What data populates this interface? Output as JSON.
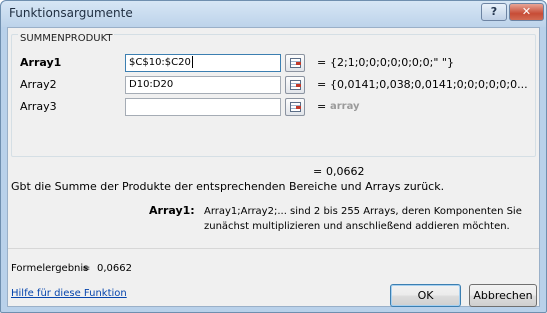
{
  "window": {
    "title": "Funktionsargumente",
    "help_button": "?",
    "close_button": "✕"
  },
  "function": {
    "name": "SUMMENPRODUKT",
    "arguments": [
      {
        "label": "Array1",
        "value": "$C$10:$C20",
        "result": "{2;1;0;0;0;0;0;0;0;\" \"}"
      },
      {
        "label": "Array2",
        "value": "D10:D20",
        "result": "{0,0141;0,038;0,0141;0;0;0;0;0;0..."
      },
      {
        "label": "Array3",
        "value": "",
        "result": "array"
      }
    ],
    "equals": "=",
    "result": "0,0662",
    "description": "Gbt die Summe der Produkte der entsprechenden Bereiche und Arrays zurück.",
    "arg_help_name": "Array1:",
    "arg_help_text": "Array1;Array2;... sind 2 bis 255 Arrays, deren Komponenten Sie zunächst multiplizieren und anschließend addieren möchten."
  },
  "footer": {
    "formula_label": "Formelergebnis",
    "formula_eq": "=",
    "formula_value": "0,0662",
    "help_link": "Hilfe für diese Funktion",
    "ok_label": "OK",
    "cancel_label": "Abbrechen"
  }
}
